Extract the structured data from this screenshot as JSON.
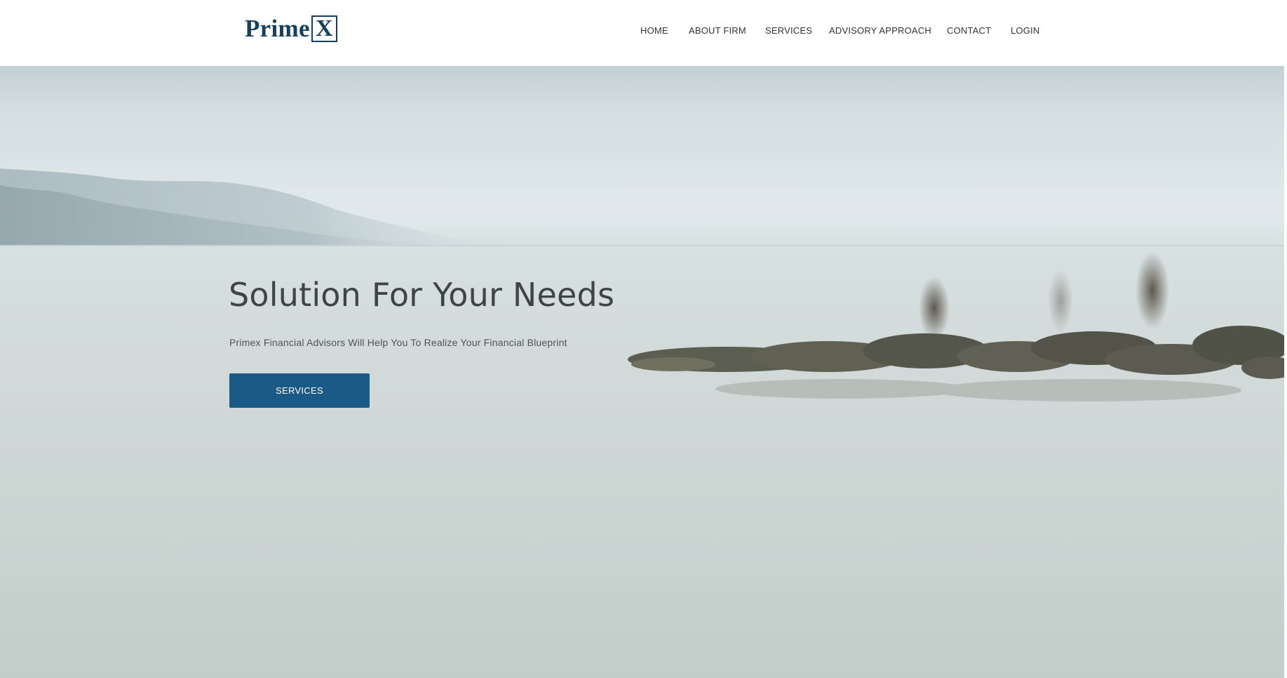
{
  "brand": {
    "logo_text": "Prime",
    "logo_mark": "X",
    "color": "#17405e"
  },
  "nav": {
    "items": [
      {
        "label": "HOME"
      },
      {
        "label": "ABOUT FIRM"
      },
      {
        "label": "SERVICES"
      },
      {
        "label": "ADVISORY APPROACH"
      },
      {
        "label": "CONTACT"
      },
      {
        "label": "LOGIN"
      }
    ]
  },
  "hero": {
    "title": "Solution For Your Needs",
    "subtitle": "Primex Financial Advisors Will Help You To Realize Your Financial Blueprint",
    "button_label": "SERVICES",
    "button_color": "#1b5a86"
  }
}
